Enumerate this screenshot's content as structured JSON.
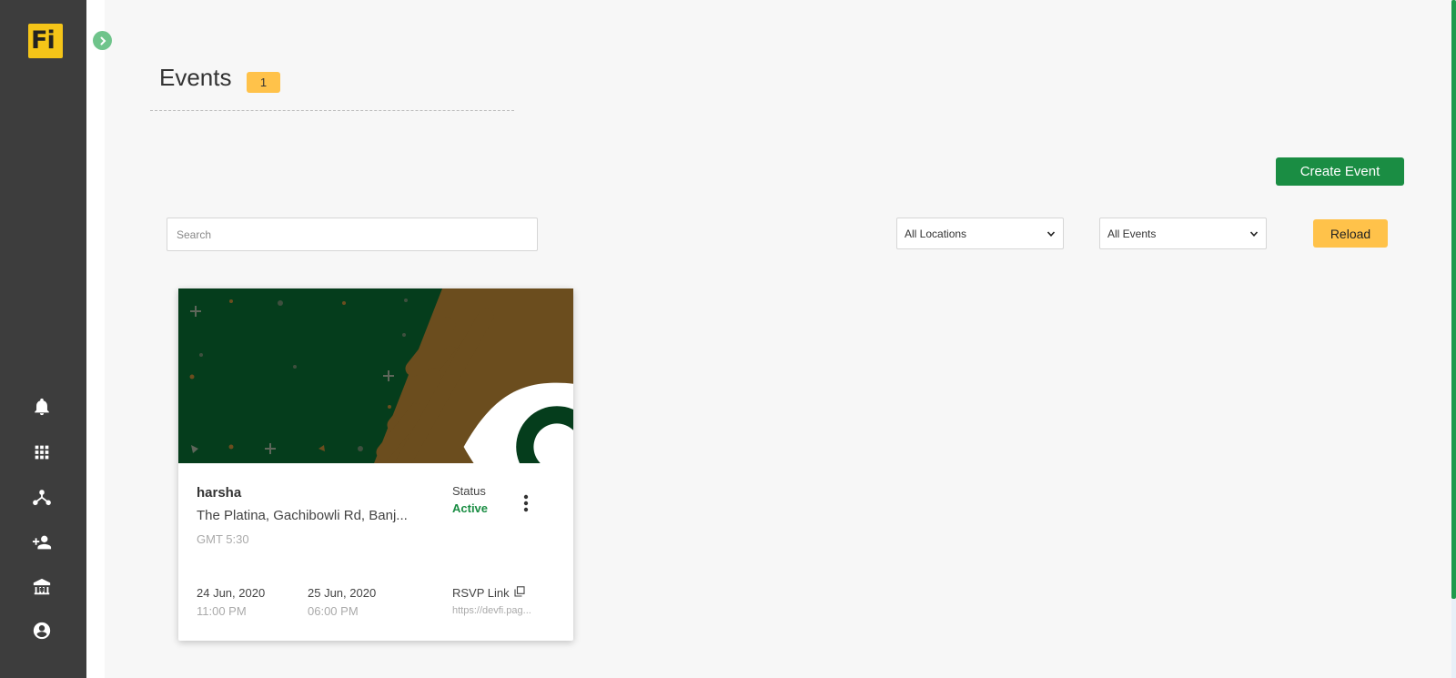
{
  "app": {
    "logo_text": "Fi",
    "brand_color": "#f5c518"
  },
  "sidebar": {
    "icons": [
      "bell-icon",
      "apps-grid-icon",
      "network-icon",
      "add-user-icon",
      "institution-icon",
      "account-icon"
    ]
  },
  "header": {
    "title": "Events",
    "count": "1"
  },
  "toolbar": {
    "create_label": "Create Event",
    "reload_label": "Reload",
    "search_placeholder": "Search",
    "location_select": {
      "selected": "All Locations"
    },
    "events_select": {
      "selected": "All Events"
    }
  },
  "events": [
    {
      "name": "harsha",
      "address": "The Platina, Gachibowli Rd, Banj...",
      "timezone": "GMT 5:30",
      "status_label": "Status",
      "status": "Active",
      "start_date": "24 Jun, 2020",
      "start_time": "11:00 PM",
      "end_date": "25 Jun, 2020",
      "end_time": "06:00 PM",
      "rsvp_label": "RSVP Link",
      "rsvp_url": "https://devfi.pag..."
    }
  ],
  "colors": {
    "primary_green": "#1a8d43",
    "accent_yellow": "#ffc24a",
    "sidebar_bg": "#3d3d3d",
    "banner_green": "#053d1c",
    "banner_brown": "#6b4d1e"
  }
}
